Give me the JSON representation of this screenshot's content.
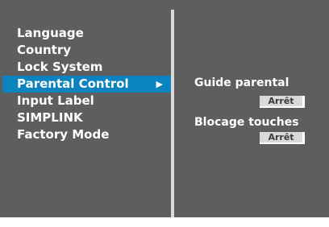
{
  "menu": {
    "items": [
      {
        "label": "Language"
      },
      {
        "label": "Country"
      },
      {
        "label": "Lock System"
      },
      {
        "label": "Parental Control",
        "selected": true,
        "arrow": "▶"
      },
      {
        "label": "Input Label"
      },
      {
        "label": "SIMPLINK"
      },
      {
        "label": "Factory Mode"
      }
    ]
  },
  "submenu": {
    "guide_label": "Guide parental",
    "guide_value": "Arrêt",
    "lock_label": "Blocage touches",
    "lock_value": "Arrêt"
  },
  "colors": {
    "panel_bg": "#5e5e5e",
    "highlight": "#0a83bf",
    "divider": "#d9d9d9",
    "text": "#ffffff"
  }
}
